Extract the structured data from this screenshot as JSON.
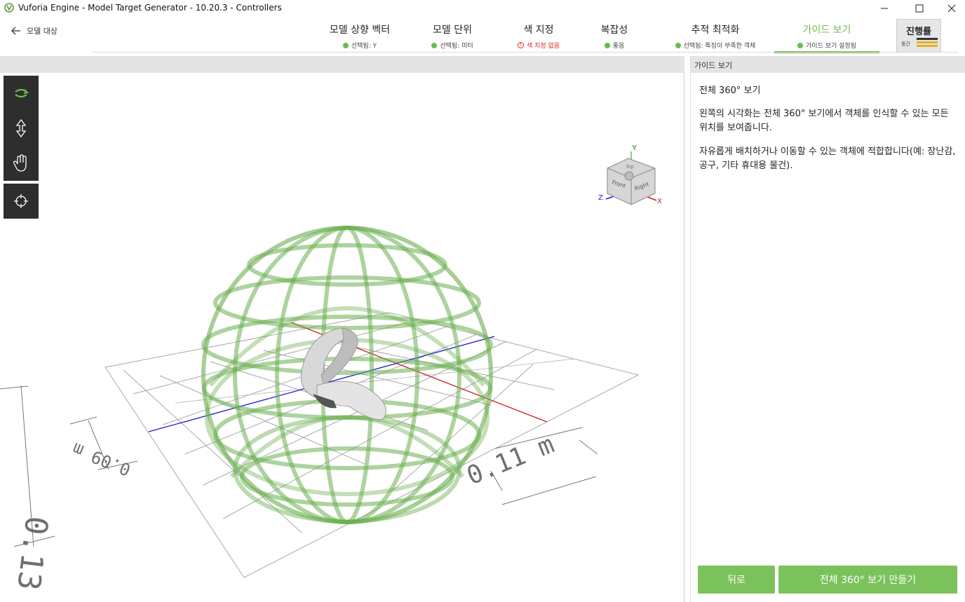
{
  "window": {
    "title": "Vuforia Engine - Model Target Generator - 10.20.3 - Controllers"
  },
  "nav": {
    "back_label": "모델 대상"
  },
  "steps": [
    {
      "title": "모델 상향 벡터",
      "sub": "선택됨: Y",
      "status": "ok"
    },
    {
      "title": "모델 단위",
      "sub": "선택됨: 미터",
      "status": "ok"
    },
    {
      "title": "색 지정",
      "sub": "색 지정 없음",
      "status": "error"
    },
    {
      "title": "복잡성",
      "sub": "좋음",
      "status": "ok"
    },
    {
      "title": "추적 최적화",
      "sub": "선택됨: 특징이 부족한 객체",
      "status": "ok"
    },
    {
      "title": "가이드 보기",
      "sub": "가이드 보기 설정됨",
      "status": "active"
    }
  ],
  "progress": {
    "title": "진행률",
    "level": "중간"
  },
  "viewport": {
    "tools": [
      "rotate-icon",
      "pan-vertical-icon",
      "hand-icon",
      "target-icon"
    ],
    "orientation_cube": {
      "axis_y": "Y",
      "axis_x": "X",
      "axis_z": "Z",
      "face_front": "Front",
      "face_right": "Right",
      "face_top": "Top"
    },
    "dimensions": {
      "height": "0.13 m",
      "depth": "0.09 m",
      "width": "0.11 m"
    }
  },
  "panel": {
    "header": "가이드 보기",
    "title": "전체 360° 보기",
    "para1": "왼쪽의 시각화는 전체 360° 보기에서 객체를 인식할 수 있는 모든 위치를 보여줍니다.",
    "para2": "자유롭게 배치하거나 이동할 수 있는 객체에 적합합니다(예: 장난감, 공구, 기타 휴대용 물건).",
    "back_button": "뒤로",
    "create_button": "전체 360° 보기 만들기"
  },
  "colors": {
    "accent": "#6dbb4f",
    "button": "#7cc25c",
    "error": "#dd2222",
    "toolbar": "#2e2e2e"
  }
}
